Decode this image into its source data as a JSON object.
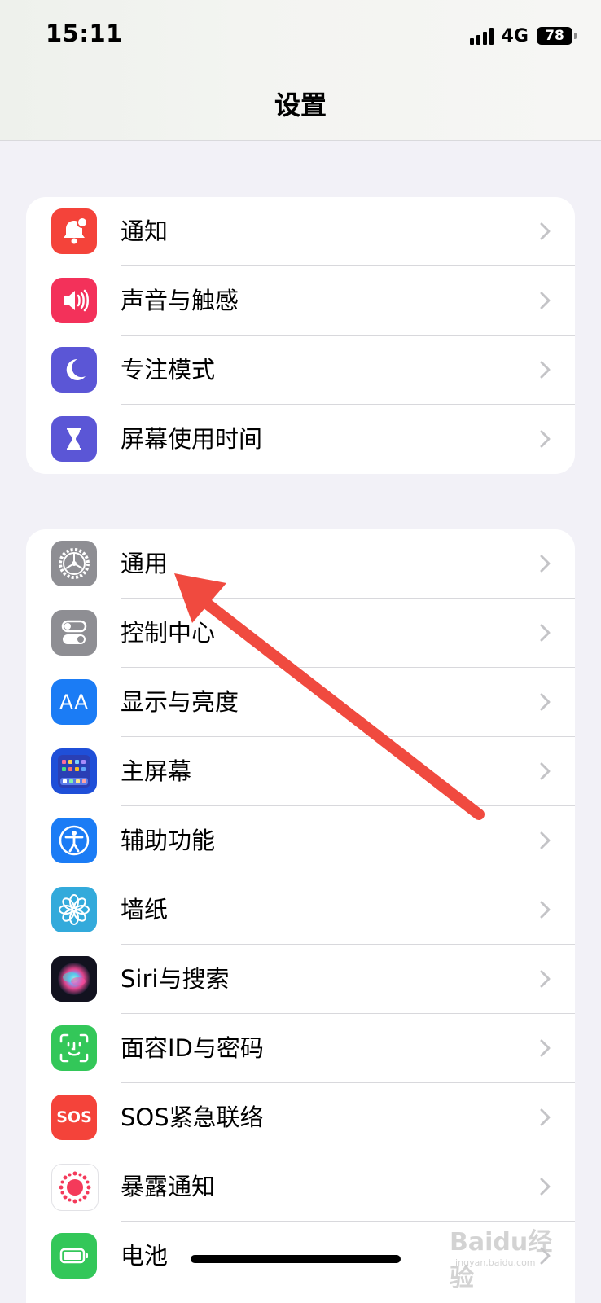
{
  "status_bar": {
    "time": "15:11",
    "network": "4G",
    "battery_level": "78"
  },
  "header": {
    "title": "设置"
  },
  "groups": [
    {
      "items": [
        {
          "label": "通知",
          "icon": "notifications-icon",
          "color": "#f4433a"
        },
        {
          "label": "声音与触感",
          "icon": "sounds-icon",
          "color": "#f3315a"
        },
        {
          "label": "专注模式",
          "icon": "focus-moon-icon",
          "color": "#5b56d6"
        },
        {
          "label": "屏幕使用时间",
          "icon": "screen-time-hourglass-icon",
          "color": "#5b56d6"
        }
      ]
    },
    {
      "items": [
        {
          "label": "通用",
          "icon": "general-gear-icon",
          "color": "#8e8e93"
        },
        {
          "label": "控制中心",
          "icon": "control-center-icon",
          "color": "#8e8e93"
        },
        {
          "label": "显示与亮度",
          "icon": "display-brightness-icon",
          "color": "#1b7cf5"
        },
        {
          "label": "主屏幕",
          "icon": "home-screen-icon",
          "color": "#1f4fd8"
        },
        {
          "label": "辅助功能",
          "icon": "accessibility-icon",
          "color": "#1b7cf5"
        },
        {
          "label": "墙纸",
          "icon": "wallpaper-flower-icon",
          "color": "#33aadb"
        },
        {
          "label": "Siri与搜索",
          "icon": "siri-icon",
          "color": "#1a1a2e"
        },
        {
          "label": "面容ID与密码",
          "icon": "face-id-icon",
          "color": "#33c759"
        },
        {
          "label": "SOS紧急联络",
          "icon": "sos-icon",
          "color": "#f4433a"
        },
        {
          "label": "暴露通知",
          "icon": "exposure-notification-icon",
          "color": "#ffffff"
        },
        {
          "label": "电池",
          "icon": "battery-icon",
          "color": "#33c759"
        }
      ]
    }
  ],
  "icon_text": {
    "display": "AA",
    "sos": "SOS"
  },
  "watermark": {
    "text": "Baidu经验",
    "sub": "jingyan.baidu.com"
  }
}
